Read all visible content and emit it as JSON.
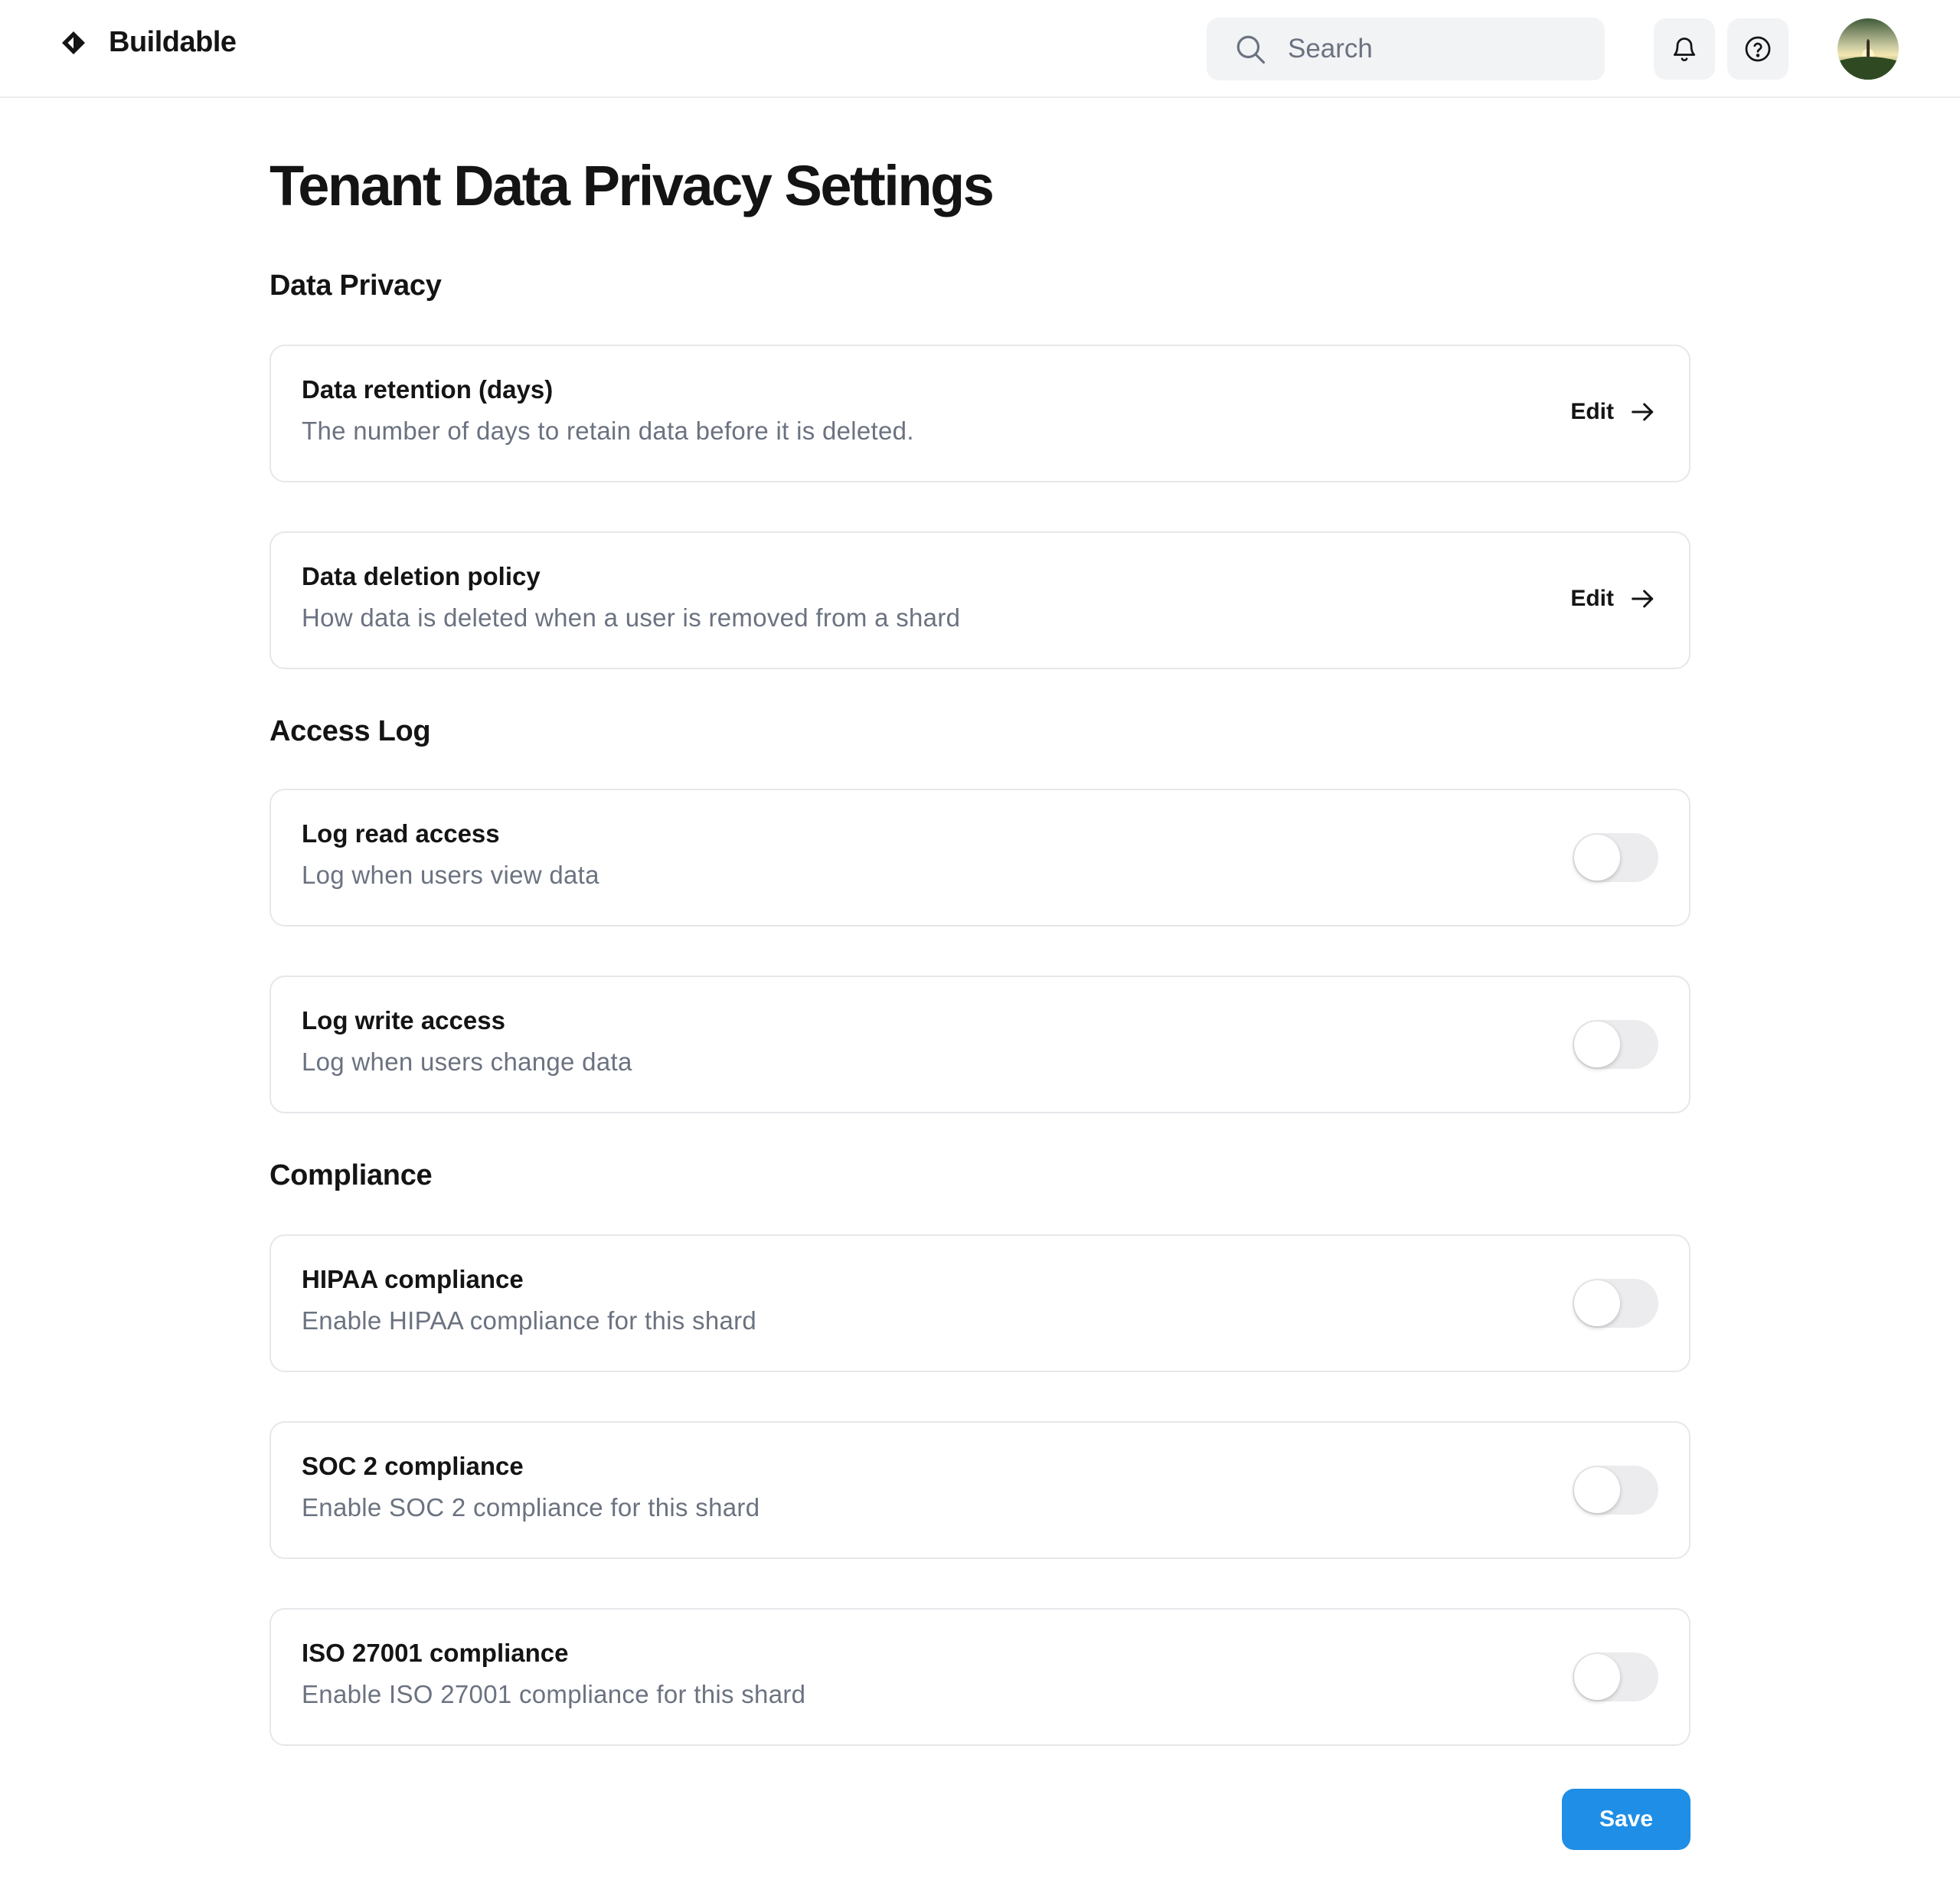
{
  "header": {
    "brand_name": "Buildable",
    "search_placeholder": "Search",
    "icons": [
      "diamond-logo-icon",
      "search-icon",
      "bell-icon",
      "help-icon"
    ]
  },
  "page": {
    "title": "Tenant Data Privacy Settings"
  },
  "sections": [
    {
      "title": "Data Privacy",
      "items": [
        {
          "title": "Data retention (days)",
          "description": "The number of days to retain data before it is deleted.",
          "control": "edit",
          "action_label": "Edit"
        },
        {
          "title": "Data deletion policy",
          "description": "How data is deleted when a user is removed from a shard",
          "control": "edit",
          "action_label": "Edit"
        }
      ]
    },
    {
      "title": "Access Log",
      "items": [
        {
          "title": "Log read access",
          "description": "Log when users view data",
          "control": "toggle",
          "enabled": false
        },
        {
          "title": "Log write access",
          "description": "Log when users change data",
          "control": "toggle",
          "enabled": false
        }
      ]
    },
    {
      "title": "Compliance",
      "items": [
        {
          "title": "HIPAA compliance",
          "description": "Enable HIPAA compliance for this shard",
          "control": "toggle",
          "enabled": false
        },
        {
          "title": "SOC 2 compliance",
          "description": "Enable SOC 2 compliance for this shard",
          "control": "toggle",
          "enabled": false
        },
        {
          "title": "ISO 27001 compliance",
          "description": "Enable ISO 27001 compliance for this shard",
          "control": "toggle",
          "enabled": false
        }
      ]
    }
  ],
  "footer": {
    "save_label": "Save"
  },
  "colors": {
    "accent": "#1e8ee6",
    "border": "#e6e7ea",
    "muted_text": "#6b7280",
    "toggle_off": "#ececee"
  }
}
